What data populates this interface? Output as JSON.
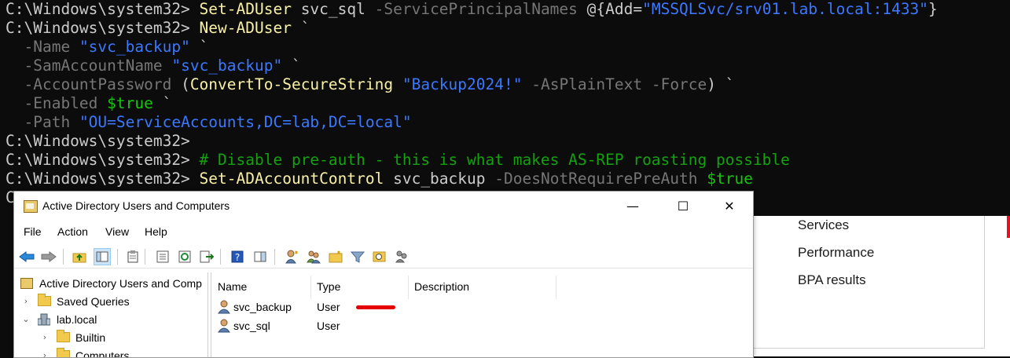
{
  "terminal": {
    "lines": [
      [
        {
          "t": "C:\\Windows\\system32> ",
          "c": "prompt"
        },
        {
          "t": "Set-ADUser",
          "c": "cmd"
        },
        {
          "t": " svc_sql ",
          "c": "arg"
        },
        {
          "t": "-ServicePrincipalNames",
          "c": "param"
        },
        {
          "t": " @{Add=",
          "c": "op"
        },
        {
          "t": "\"MSSQLSvc/srv01.lab.local:1433\"",
          "c": "str"
        },
        {
          "t": "}",
          "c": "op"
        }
      ],
      [
        {
          "t": "C:\\Windows\\system32> ",
          "c": "prompt"
        },
        {
          "t": "New-ADUser",
          "c": "cmd"
        },
        {
          "t": " `",
          "c": "op"
        }
      ],
      [
        {
          "t": "  ",
          "c": "op"
        },
        {
          "t": "-Name",
          "c": "param"
        },
        {
          "t": " ",
          "c": "op"
        },
        {
          "t": "\"svc_backup\"",
          "c": "str"
        },
        {
          "t": " `",
          "c": "op"
        }
      ],
      [
        {
          "t": "  ",
          "c": "op"
        },
        {
          "t": "-SamAccountName",
          "c": "param"
        },
        {
          "t": " ",
          "c": "op"
        },
        {
          "t": "\"svc_backup\"",
          "c": "str"
        },
        {
          "t": " `",
          "c": "op"
        }
      ],
      [
        {
          "t": "  ",
          "c": "op"
        },
        {
          "t": "-AccountPassword",
          "c": "param"
        },
        {
          "t": " (",
          "c": "op"
        },
        {
          "t": "ConvertTo-SecureString",
          "c": "cmd"
        },
        {
          "t": " ",
          "c": "op"
        },
        {
          "t": "\"Backup2024!\"",
          "c": "str"
        },
        {
          "t": " ",
          "c": "op"
        },
        {
          "t": "-AsPlainText -Force",
          "c": "param"
        },
        {
          "t": ") `",
          "c": "op"
        }
      ],
      [
        {
          "t": "  ",
          "c": "op"
        },
        {
          "t": "-Enabled",
          "c": "param"
        },
        {
          "t": " ",
          "c": "op"
        },
        {
          "t": "$true",
          "c": "var"
        },
        {
          "t": " `",
          "c": "op"
        }
      ],
      [
        {
          "t": "  ",
          "c": "op"
        },
        {
          "t": "-Path",
          "c": "param"
        },
        {
          "t": " ",
          "c": "op"
        },
        {
          "t": "\"OU=ServiceAccounts,DC=lab,DC=local\"",
          "c": "str"
        }
      ],
      [
        {
          "t": "C:\\Windows\\system32>",
          "c": "prompt"
        }
      ],
      [
        {
          "t": "C:\\Windows\\system32> ",
          "c": "prompt"
        },
        {
          "t": "# Disable pre-auth - this is what makes AS-REP roasting possible",
          "c": "cmt"
        }
      ],
      [
        {
          "t": "C:\\Windows\\system32> ",
          "c": "prompt"
        },
        {
          "t": "Set-ADAccountControl",
          "c": "cmd"
        },
        {
          "t": " svc_backup ",
          "c": "arg"
        },
        {
          "t": "-DoesNotRequirePreAuth",
          "c": "param"
        },
        {
          "t": " ",
          "c": "op"
        },
        {
          "t": "$true",
          "c": "var"
        }
      ],
      [
        {
          "t": "C",
          "c": "prompt"
        }
      ]
    ]
  },
  "server_manager": {
    "items": [
      "Services",
      "Performance",
      "BPA results"
    ]
  },
  "aduc": {
    "title": "Active Directory Users and Computers",
    "controls": {
      "minimize": "—",
      "maximize": "☐",
      "close": "✕"
    },
    "menu": [
      "File",
      "Action",
      "View",
      "Help"
    ],
    "tree": {
      "root": "Active Directory Users and Comp",
      "saved_queries": "Saved Queries",
      "domain": "lab.local",
      "builtin": "Builtin",
      "computers": "Computers"
    },
    "columns": {
      "name": "Name",
      "type": "Type",
      "description": "Description"
    },
    "rows": [
      {
        "name": "svc_backup",
        "type": "User"
      },
      {
        "name": "svc_sql",
        "type": "User"
      }
    ]
  }
}
